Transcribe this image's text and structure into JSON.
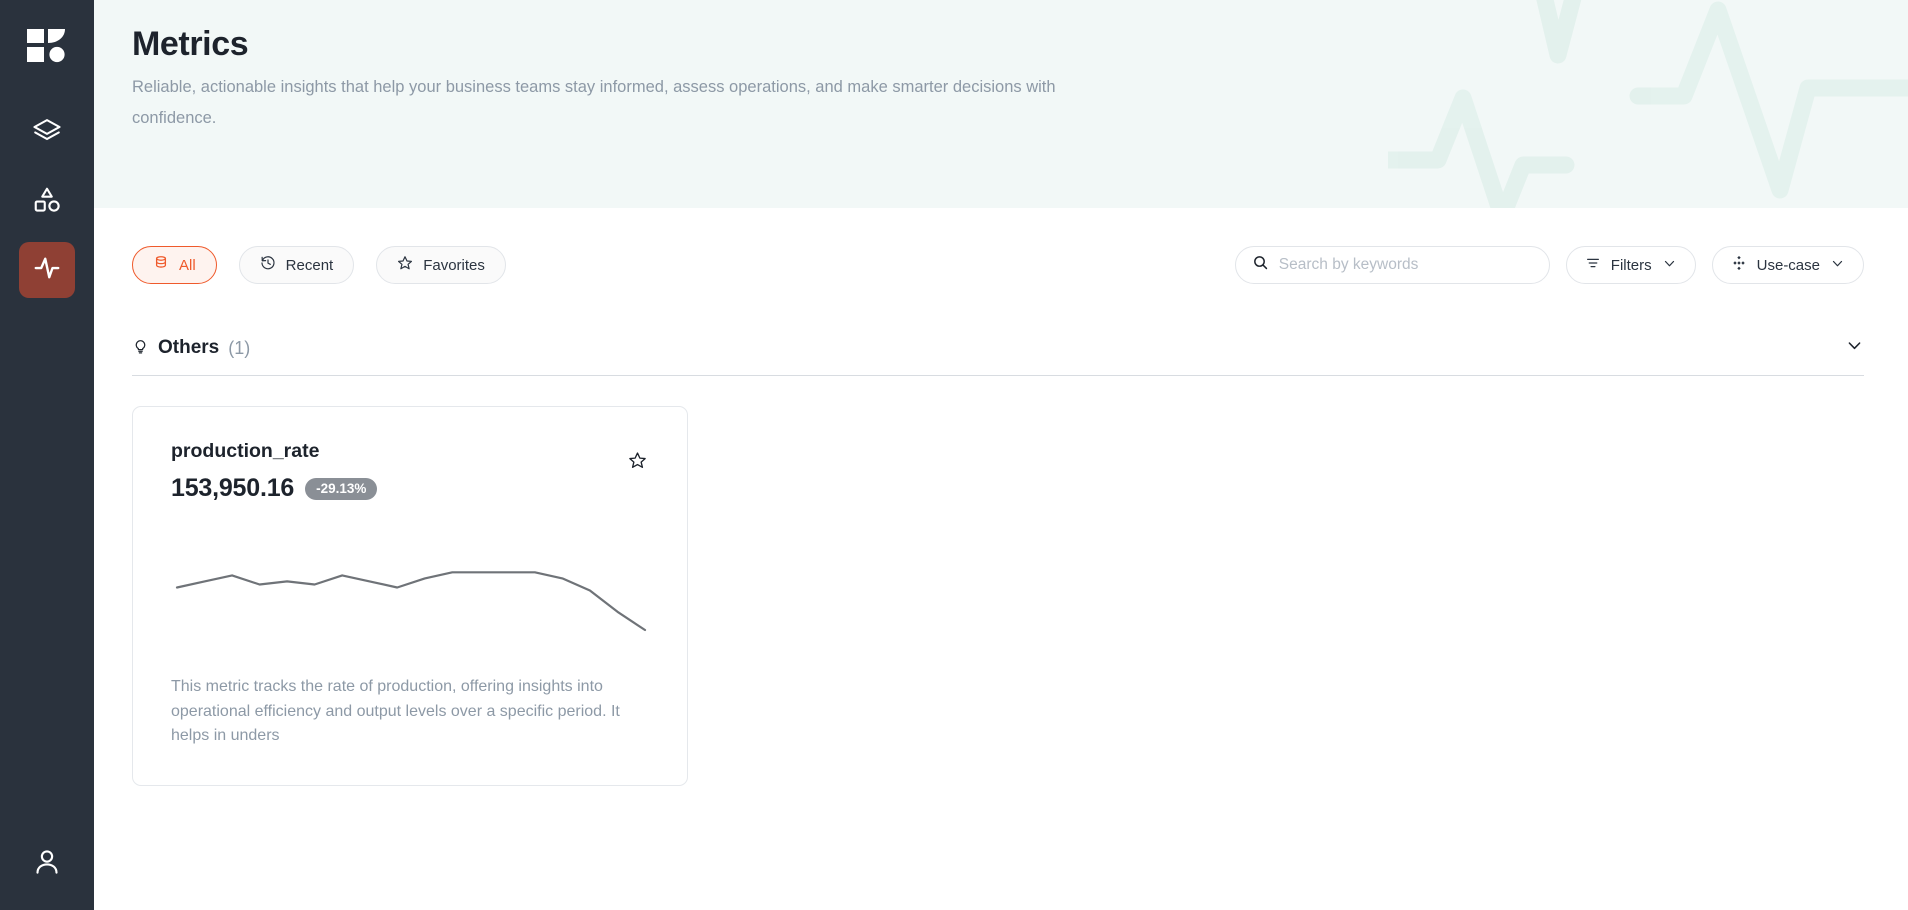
{
  "sidebar": {
    "logo": {
      "icon": "app-logo-icon"
    },
    "items": [
      {
        "icon": "layers-icon",
        "name": "layers",
        "active": false
      },
      {
        "icon": "shapes-icon",
        "name": "shapes",
        "active": false
      },
      {
        "icon": "activity-pulse-icon",
        "name": "metrics",
        "active": true
      }
    ],
    "bottom": {
      "icon": "user-profile-icon",
      "name": "profile"
    },
    "active_color": "#8f4034",
    "background": "#2a323d"
  },
  "hero": {
    "title": "Metrics",
    "subtitle": "Reliable, actionable insights that help your business teams stay informed, assess operations, and make smarter decisions with confidence.",
    "background": "#f2f8f7",
    "watermark_icon": "pulse-line-watermark"
  },
  "toolbar": {
    "chips": [
      {
        "label": "All",
        "icon": "database-icon",
        "active": true
      },
      {
        "label": "Recent",
        "icon": "history-clock-icon",
        "active": false
      },
      {
        "label": "Favorites",
        "icon": "star-icon",
        "active": false
      }
    ],
    "search": {
      "placeholder": "Search by keywords",
      "value": "",
      "icon": "search-icon"
    },
    "filters": {
      "label": "Filters",
      "icon": "filter-lines-icon",
      "chevron": "chevron-down-icon"
    },
    "usecase": {
      "label": "Use-case",
      "icon": "diamond-cluster-icon",
      "chevron": "chevron-down-icon"
    },
    "accent_color": "#ef5a2c"
  },
  "section": {
    "icon": "lightbulb-icon",
    "title": "Others",
    "count": "(1)",
    "collapse_icon": "chevron-down-icon"
  },
  "cards": [
    {
      "name": "production_rate",
      "value": "153,950.16",
      "change": "-29.13%",
      "change_color": "#8a8f96",
      "favorite_icon": "star-outline-icon",
      "favorited": false,
      "description": "This metric tracks the rate of production, offering insights into operational efficiency and output levels over a specific period. It helps in unders",
      "chart_data": {
        "type": "line",
        "title": "production_rate sparkline",
        "x": [
          0,
          1,
          2,
          3,
          4,
          5,
          6,
          7,
          8,
          9,
          10,
          11,
          12,
          13,
          14,
          15,
          16,
          17
        ],
        "values": [
          52,
          54,
          56,
          53,
          54,
          53,
          56,
          54,
          52,
          55,
          57,
          57,
          57,
          57,
          55,
          51,
          44,
          38
        ],
        "line_color": "#6f7378",
        "grid": false,
        "ylim": [
          0,
          100
        ]
      }
    }
  ]
}
